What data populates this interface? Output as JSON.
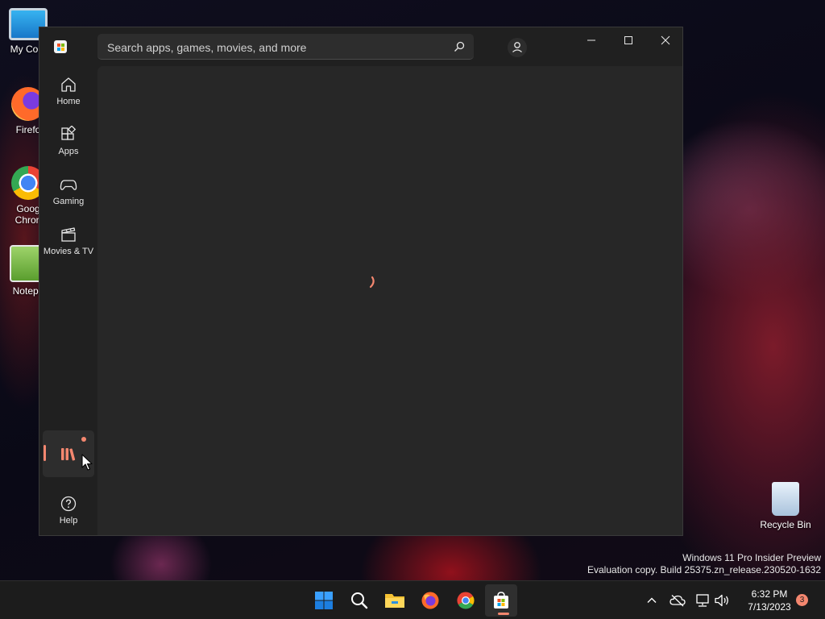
{
  "desktop": {
    "icons": [
      {
        "label": "My Com"
      },
      {
        "label": "Firefo"
      },
      {
        "label": "Goog",
        "label2": "Chron"
      },
      {
        "label": "Notepa"
      },
      {
        "label": "Recycle Bin"
      }
    ],
    "watermark": {
      "line1": "Windows 11 Pro Insider Preview",
      "line2": "Evaluation copy. Build 25375.zn_release.230520-1632"
    }
  },
  "store": {
    "search": {
      "placeholder": "Search apps, games, movies, and more"
    },
    "nav": [
      {
        "label": "Home"
      },
      {
        "label": "Apps"
      },
      {
        "label": "Gaming"
      },
      {
        "label": "Movies & TV"
      }
    ],
    "help": {
      "label": "Help"
    },
    "accent": "#f4876f"
  },
  "taskbar": {
    "clock": {
      "time": "6:32 PM",
      "date": "7/13/2023"
    },
    "notification_count": "3"
  }
}
